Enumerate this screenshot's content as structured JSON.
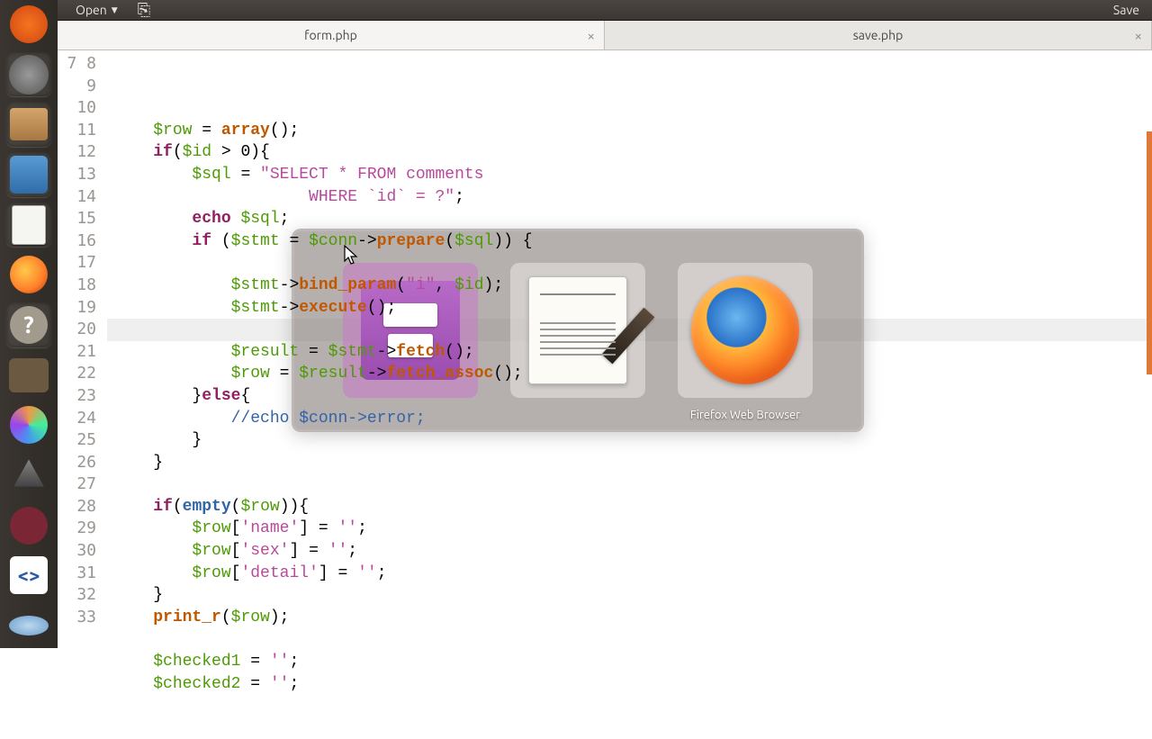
{
  "toolbar": {
    "open_label": "Open",
    "save_label": "Save"
  },
  "tabs": [
    {
      "label": "form.php",
      "active": true
    },
    {
      "label": "save.php",
      "active": false
    }
  ],
  "gutter_start": 7,
  "gutter_end": 33,
  "highlighted_line": 19,
  "code": {
    "l7": "",
    "l8": {
      "a": "$row",
      "b": " = ",
      "c": "array",
      "d": "();"
    },
    "l9": {
      "a": "if",
      "b": "(",
      "c": "$id",
      "d": " > 0){"
    },
    "l10": {
      "a": "$sql",
      "b": " = ",
      "c": "\"SELECT * FROM comments"
    },
    "l11": {
      "a": "           WHERE `id` = ?\"",
      "b": ";"
    },
    "l12": {
      "a": "echo ",
      "b": "$sql",
      "c": ";"
    },
    "l13": {
      "a": "if ",
      "b": "(",
      "c": "$stmt",
      "d": " = ",
      "e": "$conn",
      "f": "->",
      "g": "prepare",
      "h": "(",
      "i": "$sql",
      "j": ")) {"
    },
    "l14": "",
    "l15": {
      "a": "$stmt",
      "b": "->",
      "c": "bind_param",
      "d": "(",
      "e": "\"i\"",
      "f": ", ",
      "g": "$id",
      "h": ");"
    },
    "l16": {
      "a": "$stmt",
      "b": "->",
      "c": "execute",
      "d": "();"
    },
    "l17": "",
    "l18": {
      "a": "$result",
      "b": " = ",
      "c": "$stmt",
      "d": "->",
      "e": "fetch",
      "f": "();"
    },
    "l19": {
      "a": "$row",
      "b": " = ",
      "c": "$result",
      "d": "->",
      "e": "fetch_assoc",
      "f": "();"
    },
    "l20": {
      "a": "}",
      "b": "else",
      "c": "{"
    },
    "l21": {
      "a": "//echo ",
      "b": "$conn",
      "c": "->",
      "d": "error",
      "e": ";"
    },
    "l22": "}",
    "l23": "}",
    "l24": "",
    "l25": {
      "a": "if",
      "b": "(",
      "c": "empty",
      "d": "(",
      "e": "$row",
      "f": ")){"
    },
    "l26": {
      "a": "$row",
      "b": "[",
      "c": "'name'",
      "d": "] = ",
      "e": "''",
      "f": ";"
    },
    "l27": {
      "a": "$row",
      "b": "[",
      "c": "'sex'",
      "d": "] = ",
      "e": "''",
      "f": ";"
    },
    "l28": {
      "a": "$row",
      "b": "[",
      "c": "'detail'",
      "d": "] = ",
      "e": "''",
      "f": ";"
    },
    "l29": "}",
    "l30": {
      "a": "print_r",
      "b": "(",
      "c": "$row",
      "d": ");"
    },
    "l31": "",
    "l32": {
      "a": "$checked1",
      "b": " = ",
      "c": "''",
      "d": ";"
    },
    "l33": {
      "a": "$checked2",
      "b": " = ",
      "c": "''",
      "d": ";"
    }
  },
  "switcher": {
    "items": [
      {
        "name": "files",
        "label": ""
      },
      {
        "name": "gedit",
        "label": ""
      },
      {
        "name": "firefox",
        "label": "Firefox Web Browser"
      }
    ]
  },
  "launcher_items": [
    "ubuntu",
    "settings",
    "files",
    "dolphin",
    "text-editor",
    "firefox",
    "help",
    "gimp",
    "color",
    "inkscape",
    "wine",
    "bluefish",
    "disc"
  ]
}
